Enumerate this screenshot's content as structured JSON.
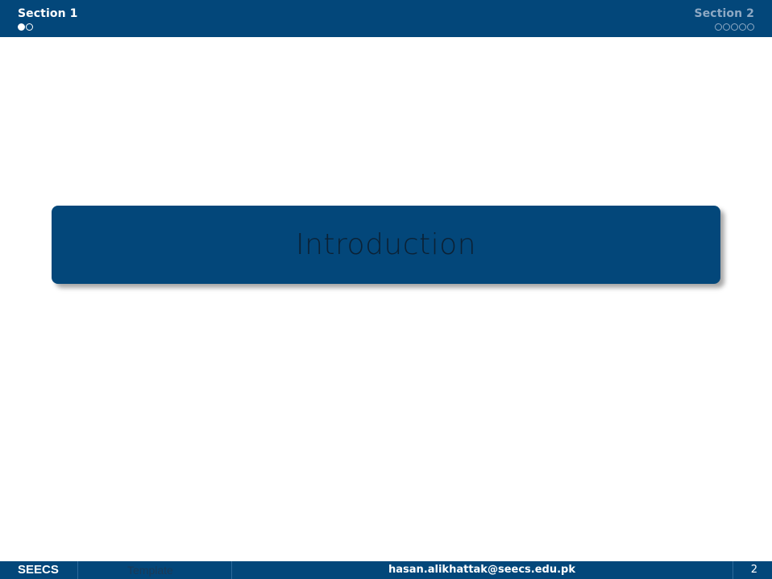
{
  "header": {
    "sections": [
      {
        "label": "Section 1",
        "active": true,
        "dots": [
          "filled",
          "hollow"
        ]
      },
      {
        "label": "Section 2",
        "active": false,
        "dots": [
          "hollow",
          "hollow",
          "hollow",
          "hollow",
          "hollow"
        ]
      }
    ]
  },
  "main": {
    "title": "Introduction"
  },
  "footer": {
    "org": "SEECS",
    "short_title": "Template",
    "email": "hasan.alikhattak@seecs.edu.pk",
    "page_number": "2"
  },
  "colors": {
    "bar": "#03477a",
    "active_text": "#ffffff",
    "inactive_text": "#8ea9c4",
    "title_text": "#0c2134"
  }
}
